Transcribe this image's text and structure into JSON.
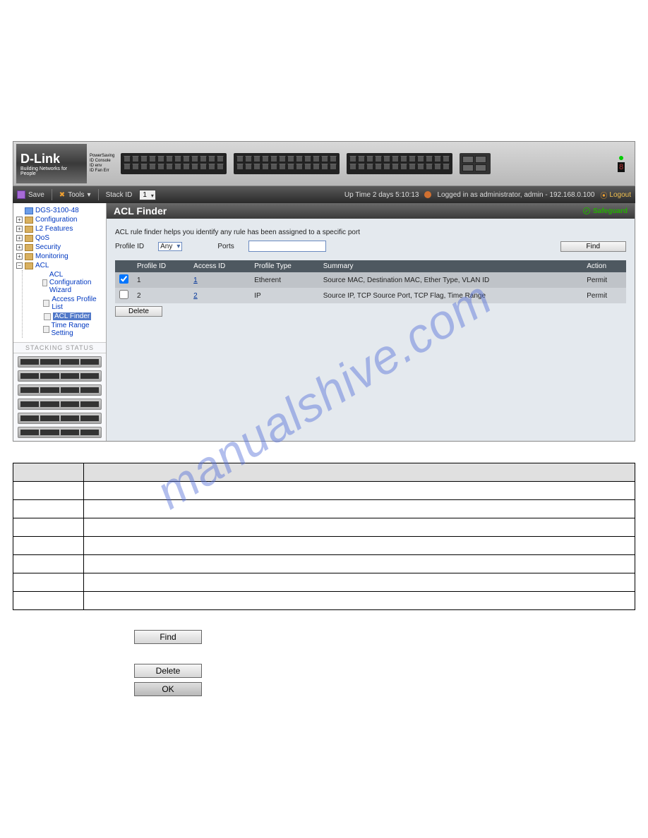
{
  "device": {
    "brand": "D-Link",
    "tagline": "Building Networks for People",
    "panel_labels": [
      "PowerSaving",
      "ID Console",
      "ID env",
      "ID Fan Err"
    ]
  },
  "toolbar": {
    "save_label": "Save",
    "tools_label": "Tools",
    "stackid_label": "Stack ID",
    "stackid_value": "1",
    "uptime": "Up Time 2 days 5:10:13",
    "login_text": "Logged in as administrator, admin - 192.168.0.100",
    "logout_label": "Logout"
  },
  "tree": {
    "root": "DGS-3100-48",
    "folders": [
      "Configuration",
      "L2 Features",
      "QoS",
      "Security",
      "Monitoring"
    ],
    "acl_label": "ACL",
    "acl_children": [
      "ACL Configuration Wizard",
      "Access Profile List",
      "ACL Finder",
      "Time Range Setting"
    ],
    "selected_index": 2
  },
  "stacking": {
    "header": "STACKING STATUS",
    "units": 6
  },
  "content": {
    "title": "ACL Finder",
    "safeguard": "Safeguard",
    "helper": "ACL rule finder helps you identify any rule has been assigned to a specific port",
    "profileid_label": "Profile ID",
    "profileid_value": "Any",
    "ports_label": "Ports",
    "ports_value": "",
    "find_label": "Find",
    "delete_label": "Delete",
    "columns": [
      "",
      "Profile ID",
      "Access ID",
      "Profile Type",
      "Summary",
      "Action"
    ],
    "rows": [
      {
        "checked": true,
        "profile_id": "1",
        "access_id": "1",
        "profile_type": "Etherent",
        "summary": "Source MAC, Destination MAC, Ether Type, VLAN ID",
        "action": "Permit"
      },
      {
        "checked": false,
        "profile_id": "2",
        "access_id": "2",
        "profile_type": "IP",
        "summary": "Source IP, TCP Source Port, TCP Flag, Time Range",
        "action": "Permit"
      }
    ]
  },
  "doc_buttons": {
    "find": "Find",
    "delete": "Delete",
    "ok": "OK"
  },
  "watermark": "manualshive.com"
}
